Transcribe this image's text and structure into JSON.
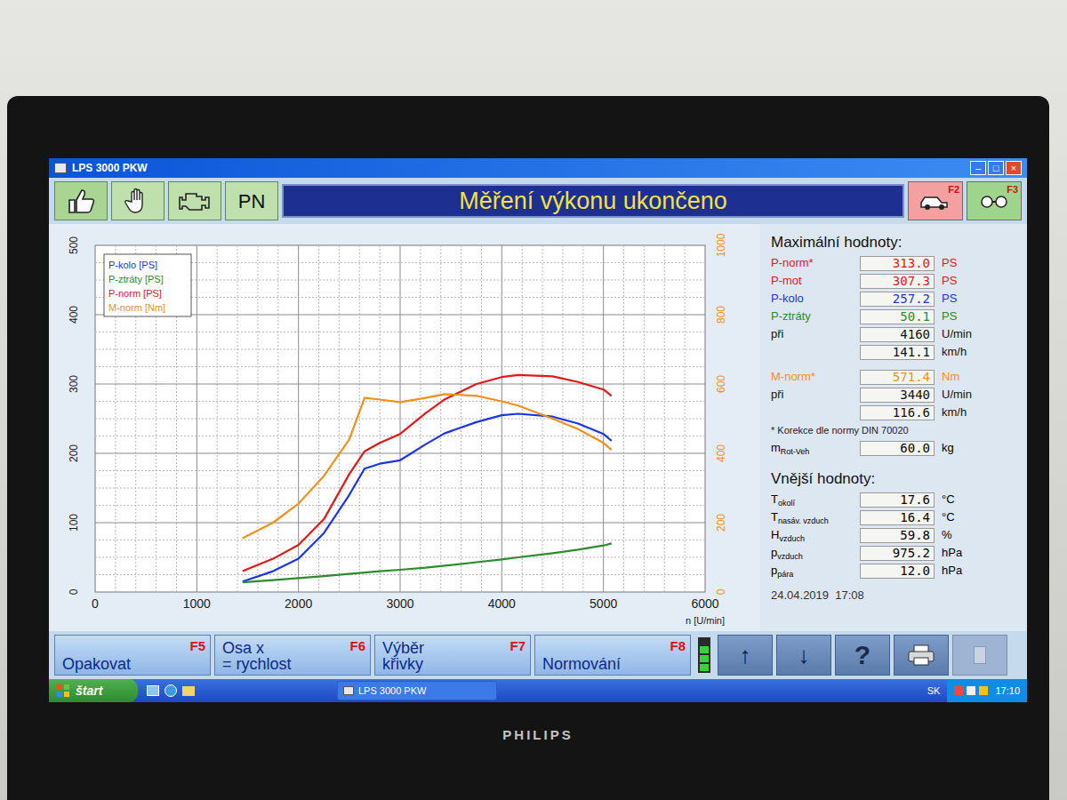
{
  "window": {
    "title": "LPS 3000 PKW",
    "controls": [
      "–",
      "□",
      "×"
    ]
  },
  "toolbar": {
    "pn": "PN",
    "banner": "Měření výkonu ukončeno",
    "right_buttons": [
      {
        "key": "F2",
        "kind": "car",
        "color": "#f2a0a0"
      },
      {
        "key": "F3",
        "kind": "rollers",
        "color": "#9fd48c"
      }
    ]
  },
  "chart": {
    "y_left_ticks": [
      "0",
      "100",
      "200",
      "300",
      "400",
      "500"
    ],
    "y_right_ticks": [
      "0",
      "200",
      "400",
      "600",
      "800",
      "1000"
    ],
    "x_ticks": [
      "0",
      "1000",
      "2000",
      "3000",
      "4000",
      "5000",
      "6000"
    ],
    "x_label": "n [U/min]",
    "n": [
      1450,
      1750,
      2000,
      2250,
      2500,
      2650,
      2800,
      3000,
      3250,
      3440,
      3750,
      4000,
      4160,
      4500,
      4750,
      5000,
      5080
    ],
    "series": [
      {
        "name": "P-kolo [PS]",
        "kind": "power",
        "color": "#1a34e6",
        "values": [
          15,
          30,
          48,
          85,
          140,
          178,
          185,
          190,
          213,
          229,
          245,
          255,
          257,
          253,
          243,
          228,
          218
        ]
      },
      {
        "name": "P-ztráty [PS]",
        "kind": "power",
        "color": "#2a8c2a",
        "values": [
          14,
          17,
          20,
          23,
          26,
          28,
          30,
          32,
          35,
          38,
          43,
          47,
          50,
          56,
          61,
          67,
          70
        ]
      },
      {
        "name": "P-norm [PS]",
        "kind": "power",
        "color": "#e01818",
        "values": [
          30,
          48,
          68,
          105,
          170,
          203,
          215,
          228,
          258,
          278,
          300,
          310,
          313,
          311,
          303,
          292,
          283
        ]
      },
      {
        "name": "M-norm [Nm]",
        "kind": "torque",
        "color": "#f0901e",
        "values": [
          155,
          200,
          255,
          335,
          440,
          560,
          555,
          548,
          560,
          571,
          566,
          550,
          538,
          500,
          470,
          430,
          410
        ]
      }
    ]
  },
  "max_values": {
    "title": "Maximální hodnoty:",
    "groups": [
      [
        {
          "label": "P-norm*",
          "value": "313.0",
          "unit": "PS",
          "color": "#e01818"
        },
        {
          "label": "P-mot",
          "value": "307.3",
          "unit": "PS",
          "color": "#e01818"
        },
        {
          "label": "P-kolo",
          "value": "257.2",
          "unit": "PS",
          "color": "#1a34e6"
        },
        {
          "label": "P-ztráty",
          "value": "50.1",
          "unit": "PS",
          "color": "#2a8c2a"
        },
        {
          "label": "při",
          "value": "4160",
          "unit": "U/min",
          "color": "#111111"
        },
        {
          "label": "",
          "value": "141.1",
          "unit": "km/h",
          "color": "#111111"
        }
      ],
      [
        {
          "label": "M-norm*",
          "value": "571.4",
          "unit": "Nm",
          "color": "#f0901e"
        },
        {
          "label": "při",
          "value": "3440",
          "unit": "U/min",
          "color": "#111111"
        },
        {
          "label": "",
          "value": "116.6",
          "unit": "km/h",
          "color": "#111111"
        }
      ]
    ],
    "note": "* Korekce dle normy DIN 70020",
    "mass": {
      "label": "m",
      "sub": "Rot-Veh",
      "value": "60.0",
      "unit": "kg"
    }
  },
  "external": {
    "title": "Vnější hodnoty:",
    "rows": [
      {
        "label": "T",
        "sub": "okolí",
        "value": "17.6",
        "unit": "°C"
      },
      {
        "label": "T",
        "sub": "nasáv. vzduch",
        "value": "16.4",
        "unit": "°C"
      },
      {
        "label": "H",
        "sub": "vzduch",
        "value": "59.8",
        "unit": "%"
      },
      {
        "label": "p",
        "sub": "vzduch",
        "value": "975.2",
        "unit": "hPa"
      },
      {
        "label": "p",
        "sub": "pára",
        "value": "12.0",
        "unit": "hPa"
      }
    ]
  },
  "timestamp": "24.04.2019  17:08",
  "buttons": [
    {
      "lines": [
        "Opakovat"
      ],
      "key": "F5"
    },
    {
      "lines": [
        "Osa x",
        "= rychlost"
      ],
      "key": "F6"
    },
    {
      "lines": [
        "Výběr",
        "křivky"
      ],
      "key": "F7"
    },
    {
      "lines": [
        "Normování"
      ],
      "key": "F8"
    }
  ],
  "indicator": {
    "on": true
  },
  "nav_buttons": [
    {
      "kind": "arrow",
      "label": "↑",
      "disabled": false
    },
    {
      "kind": "arrow",
      "label": "↓",
      "disabled": false
    },
    {
      "kind": "help",
      "label": "?",
      "disabled": false
    },
    {
      "kind": "print",
      "label": "",
      "disabled": false
    },
    {
      "kind": "blank",
      "label": "",
      "disabled": true
    }
  ],
  "taskbar": {
    "start": "štart",
    "tasks": [
      {
        "label": "LPS 3000 PKW",
        "selected": false
      }
    ],
    "lang": "SK",
    "clock": "17:10"
  },
  "monitor": {
    "brand": "PHILIPS"
  }
}
